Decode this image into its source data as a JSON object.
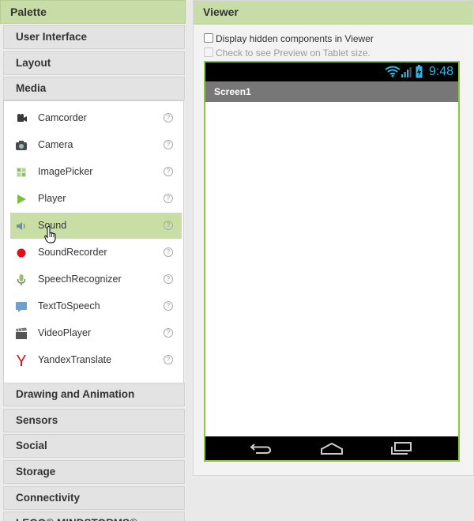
{
  "palette": {
    "title": "Palette",
    "categories_top": [
      "User Interface",
      "Layout",
      "Media"
    ],
    "media_components": [
      {
        "label": "Camcorder",
        "icon": "camcorder-icon"
      },
      {
        "label": "Camera",
        "icon": "camera-icon"
      },
      {
        "label": "ImagePicker",
        "icon": "image-picker-icon"
      },
      {
        "label": "Player",
        "icon": "player-icon"
      },
      {
        "label": "Sound",
        "icon": "sound-icon",
        "selected": true
      },
      {
        "label": "SoundRecorder",
        "icon": "sound-recorder-icon"
      },
      {
        "label": "SpeechRecognizer",
        "icon": "speech-recognizer-icon"
      },
      {
        "label": "TextToSpeech",
        "icon": "text-to-speech-icon"
      },
      {
        "label": "VideoPlayer",
        "icon": "video-player-icon"
      },
      {
        "label": "YandexTranslate",
        "icon": "yandex-translate-icon"
      }
    ],
    "help_glyph": "?",
    "categories_bottom": [
      "Drawing and Animation",
      "Sensors",
      "Social",
      "Storage",
      "Connectivity",
      "LEGO® MINDSTORMS®"
    ]
  },
  "viewer": {
    "title": "Viewer",
    "display_hidden_label": "Display hidden components in Viewer",
    "tablet_preview_label": "Check to see Preview on Tablet size.",
    "phone": {
      "time": "9:48",
      "screen_title": "Screen1"
    }
  },
  "colors": {
    "header_green": "#c7dca6",
    "selected_green": "#c9dea5",
    "phone_border": "#8cc63f",
    "status_accent": "#33b5e5"
  }
}
